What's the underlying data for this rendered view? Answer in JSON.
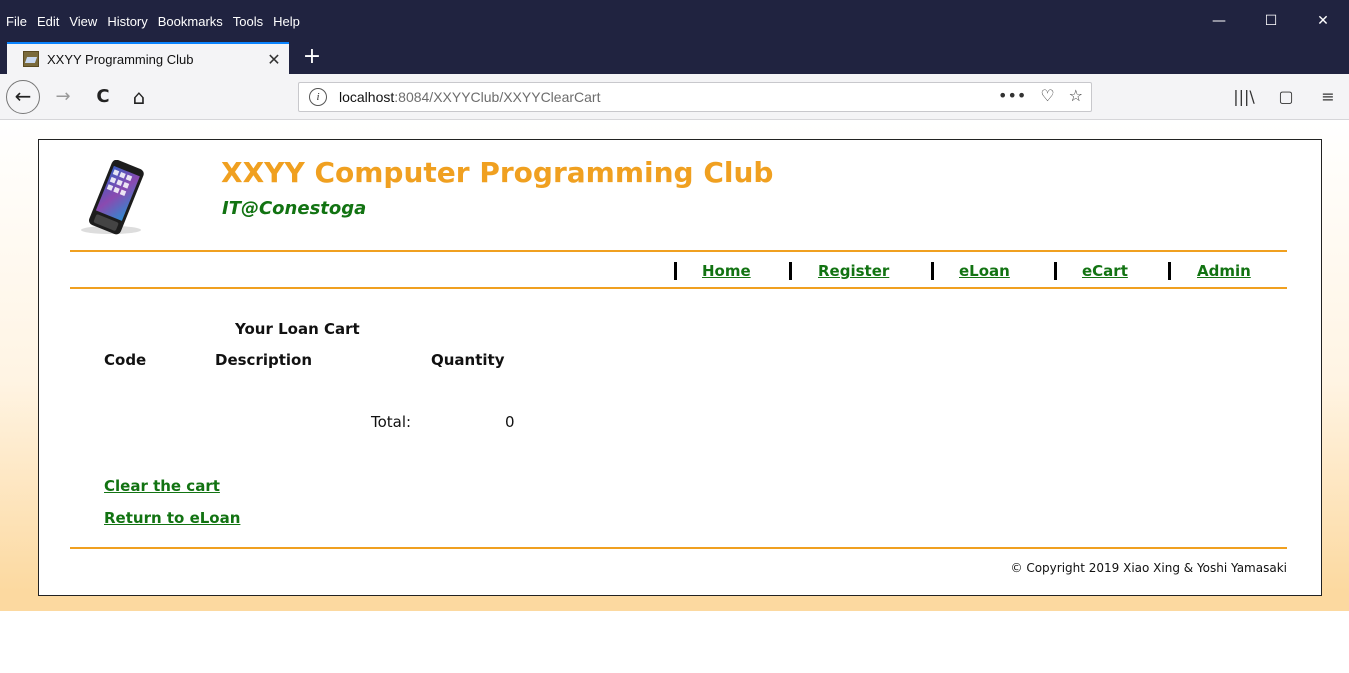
{
  "browser": {
    "menu": [
      "File",
      "Edit",
      "View",
      "History",
      "Bookmarks",
      "Tools",
      "Help"
    ],
    "window_controls": {
      "minimize": "—",
      "maximize": "☐",
      "close": "✕"
    },
    "tab": {
      "title": "XXYY Programming Club",
      "close": "✕"
    },
    "new_tab": "+",
    "nav": {
      "back": "←",
      "forward": "→",
      "reload": "C",
      "home": "⌂"
    },
    "url": {
      "host": "localhost",
      "path": ":8084/XXYYClub/XXYYClearCart",
      "info_icon": "i"
    },
    "url_actions": {
      "more": "•••",
      "pocket": "♡",
      "bookmark": "☆"
    },
    "tools": {
      "library": "|||\\",
      "sidebar": "▢",
      "menu": "≡"
    }
  },
  "site": {
    "title": "XXYY Computer Programming Club",
    "subtitle": "IT@Conestoga",
    "nav": [
      "Home",
      "Register",
      "eLoan",
      "eCart",
      "Admin"
    ]
  },
  "cart": {
    "heading": "Your Loan Cart",
    "columns": [
      "Code",
      "Description",
      "Quantity"
    ],
    "total_label": "Total:",
    "total_value": "0"
  },
  "links": {
    "clear": "Clear the cart",
    "return": "Return to eLoan"
  },
  "footer": {
    "copyright": "© Copyright 2019 Xiao Xing & Yoshi Yamasaki"
  },
  "colors": {
    "accent": "#f0a020",
    "link": "#127312",
    "chrome": "#202340"
  }
}
